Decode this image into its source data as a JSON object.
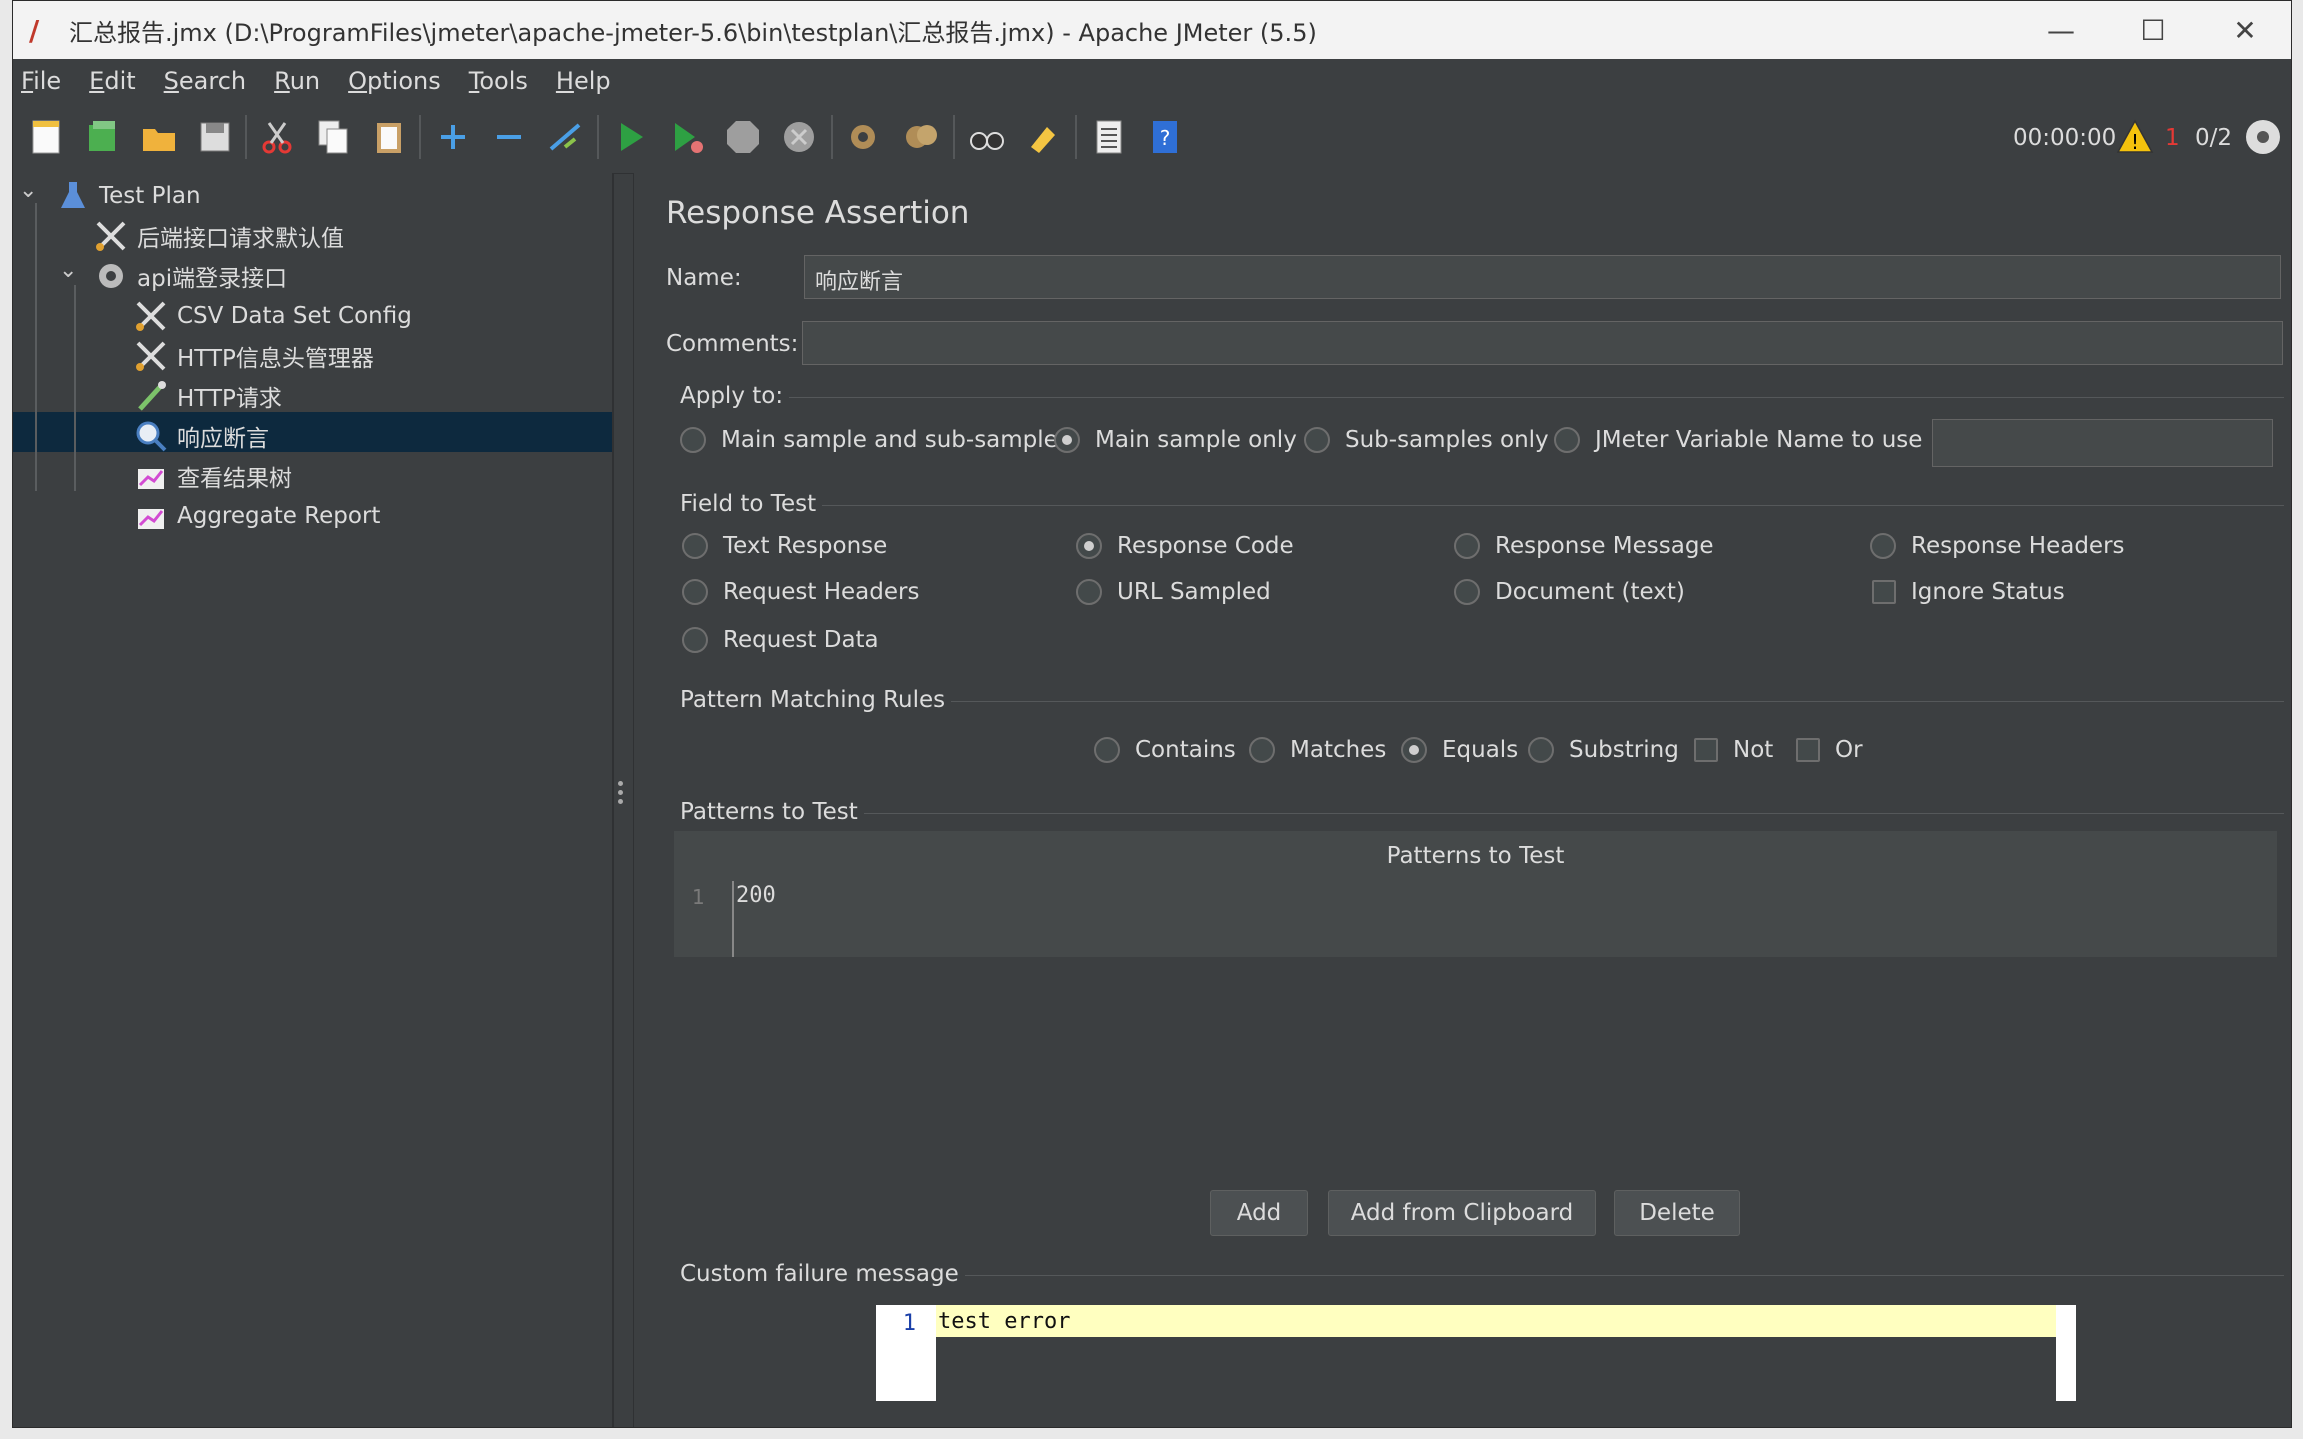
{
  "window": {
    "title": "汇总报告.jmx (D:\\ProgramFiles\\jmeter\\apache-jmeter-5.6\\bin\\testplan\\汇总报告.jmx) - Apache JMeter (5.5)",
    "controls": {
      "minimize": "—",
      "maximize": "☐",
      "close": "✕"
    }
  },
  "menu": [
    {
      "mnemonic": "F",
      "rest": "ile"
    },
    {
      "mnemonic": "E",
      "rest": "dit"
    },
    {
      "mnemonic": "S",
      "rest": "earch"
    },
    {
      "mnemonic": "R",
      "rest": "un"
    },
    {
      "mnemonic": "O",
      "rest": "ptions"
    },
    {
      "mnemonic": "T",
      "rest": "ools"
    },
    {
      "mnemonic": "H",
      "rest": "elp"
    }
  ],
  "toolbar": {
    "timer": "00:00:00",
    "error_count": "1",
    "threads": "0/2"
  },
  "tree": {
    "nodes": [
      {
        "label": "Test Plan",
        "icon": "flask-icon"
      },
      {
        "label": "后端接口请求默认值",
        "icon": "wrench-scissors-icon"
      },
      {
        "label": "api端登录接口",
        "icon": "gear-icon"
      },
      {
        "label": "CSV Data Set Config",
        "icon": "wrench-scissors-icon"
      },
      {
        "label": "HTTP信息头管理器",
        "icon": "wrench-scissors-icon"
      },
      {
        "label": "HTTP请求",
        "icon": "pipette-icon"
      },
      {
        "label": "响应断言",
        "icon": "magnifier-icon"
      },
      {
        "label": "查看结果树",
        "icon": "chart-icon"
      },
      {
        "label": "Aggregate Report",
        "icon": "chart-icon"
      }
    ]
  },
  "assertion": {
    "title": "Response Assertion",
    "name_label": "Name:",
    "name_value": "响应断言",
    "comments_label": "Comments:",
    "comments_value": "",
    "apply_to": {
      "title": "Apply to:",
      "options": [
        "Main sample and sub-samples",
        "Main sample only",
        "Sub-samples only",
        "JMeter Variable Name to use"
      ],
      "selected": "Main sample only",
      "variable_value": ""
    },
    "field_to_test": {
      "title": "Field to Test",
      "options": [
        "Text Response",
        "Response Code",
        "Response Message",
        "Response Headers",
        "Request Headers",
        "URL Sampled",
        "Document (text)",
        "Request Data"
      ],
      "selected": "Response Code",
      "ignore_status": "Ignore Status"
    },
    "pattern_rules": {
      "title": "Pattern Matching Rules",
      "options": [
        "Contains",
        "Matches",
        "Equals",
        "Substring"
      ],
      "selected": "Equals",
      "not": "Not",
      "or": "Or"
    },
    "patterns": {
      "title": "Patterns to Test",
      "column": "Patterns to Test",
      "rows": [
        {
          "num": "1",
          "value": "200"
        }
      ],
      "buttons": {
        "add": "Add",
        "clipboard": "Add from Clipboard",
        "delete": "Delete"
      }
    },
    "failure": {
      "title": "Custom failure message",
      "line_number": "1",
      "text": "test error"
    }
  }
}
